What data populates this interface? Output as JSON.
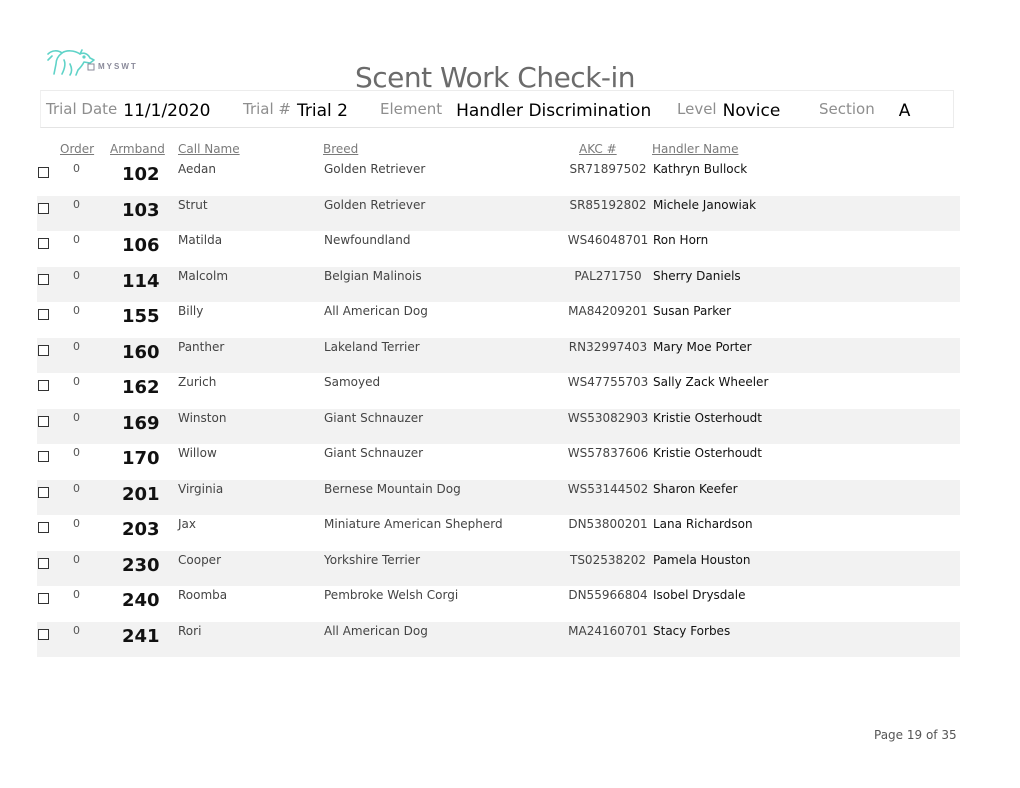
{
  "header": {
    "logo_text": "MYSWT",
    "title": "Scent Work Check-in"
  },
  "trial_info": {
    "trial_date_label": "Trial Date",
    "trial_date": "11/1/2020",
    "trial_num_label": "Trial #",
    "trial_num": "Trial 2",
    "element_label": "Element",
    "element": "Handler Discrimination",
    "level_label": "Level",
    "level": "Novice",
    "section_label": "Section",
    "section": "A"
  },
  "table": {
    "columns": {
      "order": "Order",
      "armband": "Armband",
      "call_name": "Call Name",
      "breed": "Breed",
      "akc": "AKC #",
      "handler": "Handler Name"
    },
    "rows": [
      {
        "checked": false,
        "order": "0",
        "armband": "102",
        "call_name": "Aedan",
        "breed": "Golden Retriever",
        "akc": "SR71897502",
        "handler": "Kathryn Bullock"
      },
      {
        "checked": false,
        "order": "0",
        "armband": "103",
        "call_name": "Strut",
        "breed": "Golden Retriever",
        "akc": "SR85192802",
        "handler": "Michele Janowiak"
      },
      {
        "checked": false,
        "order": "0",
        "armband": "106",
        "call_name": "Matilda",
        "breed": "Newfoundland",
        "akc": "WS46048701",
        "handler": "Ron Horn"
      },
      {
        "checked": false,
        "order": "0",
        "armband": "114",
        "call_name": "Malcolm",
        "breed": "Belgian Malinois",
        "akc": "PAL271750",
        "handler": "Sherry Daniels"
      },
      {
        "checked": false,
        "order": "0",
        "armband": "155",
        "call_name": "Billy",
        "breed": "All American Dog",
        "akc": "MA84209201",
        "handler": "Susan Parker"
      },
      {
        "checked": false,
        "order": "0",
        "armband": "160",
        "call_name": "Panther",
        "breed": "Lakeland Terrier",
        "akc": "RN32997403",
        "handler": "Mary Moe Porter"
      },
      {
        "checked": false,
        "order": "0",
        "armband": "162",
        "call_name": "Zurich",
        "breed": "Samoyed",
        "akc": "WS47755703",
        "handler": "Sally Zack Wheeler"
      },
      {
        "checked": false,
        "order": "0",
        "armband": "169",
        "call_name": "Winston",
        "breed": "Giant Schnauzer",
        "akc": "WS53082903",
        "handler": "Kristie Osterhoudt"
      },
      {
        "checked": false,
        "order": "0",
        "armband": "170",
        "call_name": "Willow",
        "breed": "Giant Schnauzer",
        "akc": "WS57837606",
        "handler": "Kristie Osterhoudt"
      },
      {
        "checked": false,
        "order": "0",
        "armband": "201",
        "call_name": "Virginia",
        "breed": "Bernese Mountain Dog",
        "akc": "WS53144502",
        "handler": "Sharon Keefer"
      },
      {
        "checked": false,
        "order": "0",
        "armband": "203",
        "call_name": "Jax",
        "breed": "Miniature American Shepherd",
        "akc": "DN53800201",
        "handler": "Lana Richardson"
      },
      {
        "checked": false,
        "order": "0",
        "armband": "230",
        "call_name": "Cooper",
        "breed": "Yorkshire Terrier",
        "akc": "TS02538202",
        "handler": "Pamela Houston"
      },
      {
        "checked": false,
        "order": "0",
        "armband": "240",
        "call_name": "Roomba",
        "breed": "Pembroke Welsh Corgi",
        "akc": "DN55966804",
        "handler": "Isobel Drysdale"
      },
      {
        "checked": false,
        "order": "0",
        "armband": "241",
        "call_name": "Rori",
        "breed": "All American Dog",
        "akc": "MA24160701",
        "handler": "Stacy Forbes"
      }
    ]
  },
  "footer": {
    "page_text": "Page 19 of 35"
  },
  "colors": {
    "logo_accent": "#5fd3c8",
    "row_alt_bg": "#f2f2f2",
    "label_gray": "#8e8e8e"
  }
}
